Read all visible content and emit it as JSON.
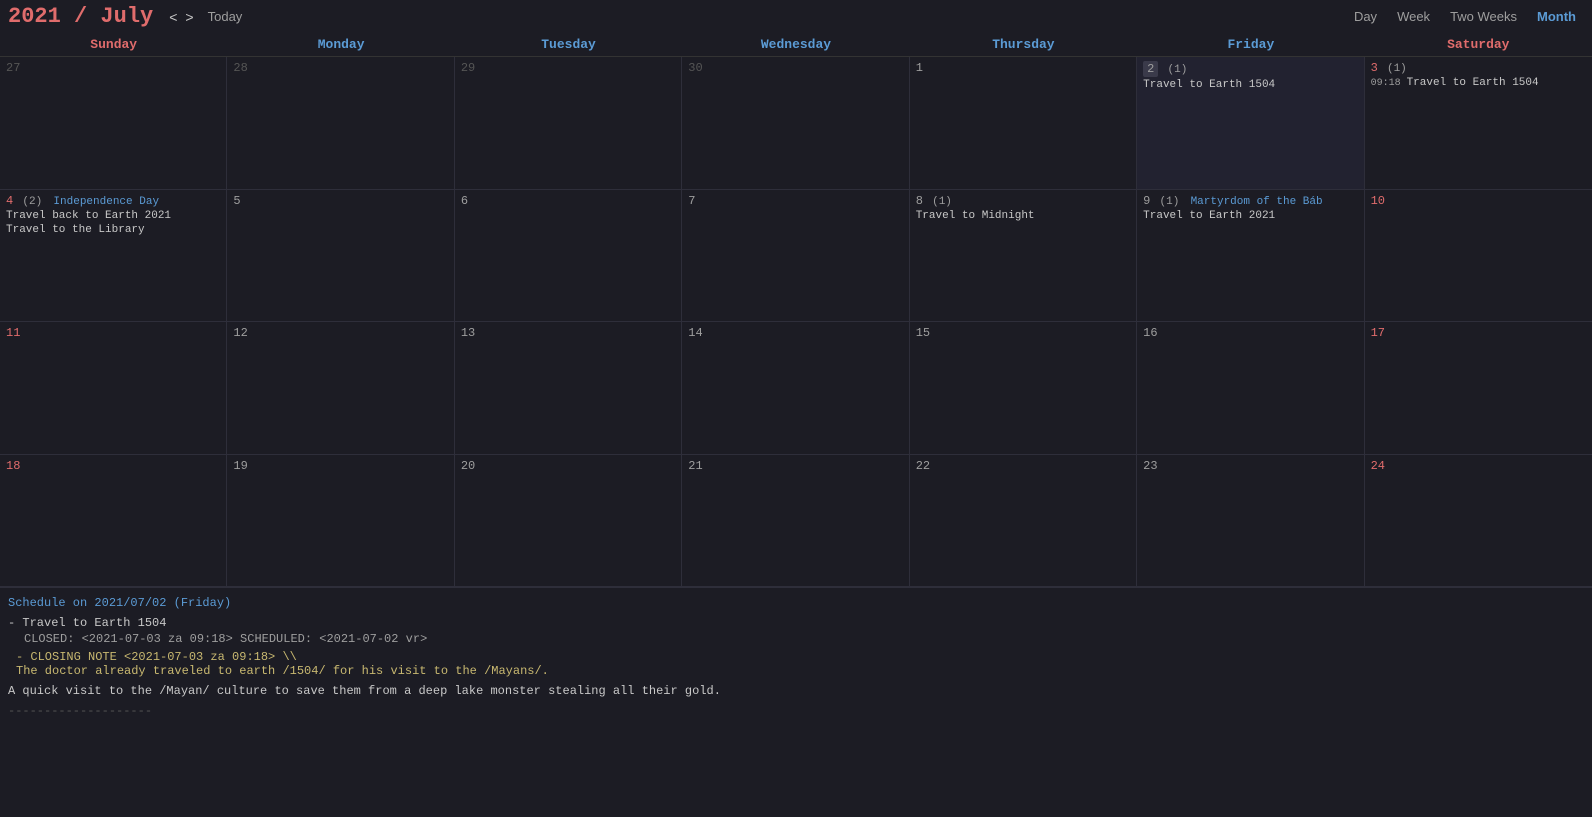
{
  "header": {
    "year": "2021",
    "slash": " / ",
    "month": "July",
    "nav_prev": "<",
    "nav_next": ">",
    "today_label": "Today",
    "views": [
      "Day",
      "Week",
      "Two Weeks",
      "Month"
    ],
    "active_view": "Month"
  },
  "day_headers": [
    {
      "label": "Sunday",
      "type": "weekend"
    },
    {
      "label": "Monday",
      "type": "weekday"
    },
    {
      "label": "Tuesday",
      "type": "weekday"
    },
    {
      "label": "Wednesday",
      "type": "weekday"
    },
    {
      "label": "Thursday",
      "type": "weekday"
    },
    {
      "label": "Friday",
      "type": "weekday"
    },
    {
      "label": "Saturday",
      "type": "weekend"
    }
  ],
  "weeks": [
    {
      "days": [
        {
          "num": "27",
          "type": "prev",
          "events": []
        },
        {
          "num": "28",
          "type": "prev",
          "events": []
        },
        {
          "num": "29",
          "type": "prev",
          "events": []
        },
        {
          "num": "30",
          "type": "prev",
          "events": []
        },
        {
          "num": "1",
          "type": "normal",
          "events": []
        },
        {
          "num": "2",
          "extra": "(1)",
          "type": "today",
          "events": [
            "Travel to Earth 1504"
          ]
        },
        {
          "num": "3",
          "extra": "(1)",
          "type": "sat",
          "events": [
            "09:18 Travel to Earth 1504"
          ]
        }
      ]
    },
    {
      "days": [
        {
          "num": "4",
          "extra": "(2)",
          "holiday": "Independence Day",
          "type": "sun",
          "events": [
            "Travel back to Earth 2021",
            "Travel to the Library"
          ]
        },
        {
          "num": "5",
          "type": "normal",
          "events": []
        },
        {
          "num": "6",
          "type": "normal",
          "events": []
        },
        {
          "num": "7",
          "type": "normal",
          "events": []
        },
        {
          "num": "8",
          "extra": "(1)",
          "type": "normal",
          "events": [
            "Travel to Midnight"
          ]
        },
        {
          "num": "9",
          "extra": "(1)",
          "holiday": "Martyrdom of the Báb",
          "type": "normal",
          "events": [
            "Travel to Earth 2021"
          ]
        },
        {
          "num": "10",
          "type": "sat",
          "events": []
        }
      ]
    },
    {
      "days": [
        {
          "num": "11",
          "type": "sun",
          "events": []
        },
        {
          "num": "12",
          "type": "normal",
          "events": []
        },
        {
          "num": "13",
          "type": "normal",
          "events": []
        },
        {
          "num": "14",
          "type": "normal",
          "events": []
        },
        {
          "num": "15",
          "type": "normal",
          "events": []
        },
        {
          "num": "16",
          "type": "normal",
          "events": []
        },
        {
          "num": "17",
          "type": "sat",
          "events": []
        }
      ]
    },
    {
      "days": [
        {
          "num": "18",
          "type": "sun",
          "events": []
        },
        {
          "num": "19",
          "type": "normal",
          "events": []
        },
        {
          "num": "20",
          "type": "normal",
          "events": []
        },
        {
          "num": "21",
          "type": "normal",
          "events": []
        },
        {
          "num": "22",
          "type": "normal",
          "events": []
        },
        {
          "num": "23",
          "type": "normal",
          "events": []
        },
        {
          "num": "24",
          "type": "sat",
          "events": []
        }
      ]
    }
  ],
  "detail": {
    "header": "Schedule on 2021/07/02 (Friday)",
    "entries": [
      {
        "title": "- Travel to Earth 1504",
        "meta": "CLOSED: <2021-07-03 za 09:18> SCHEDULED: <2021-07-02 vr>",
        "closing_label": "- CLOSING NOTE <2021-07-03 za 09:18> \\\\",
        "closing_body": "  The doctor already traveled to earth /1504/ for his visit to the /Mayans/.",
        "quick": "A quick visit to the /Mayan/ culture to save them from a deep lake monster stealing all their gold."
      }
    ],
    "separator": "--------------------"
  }
}
